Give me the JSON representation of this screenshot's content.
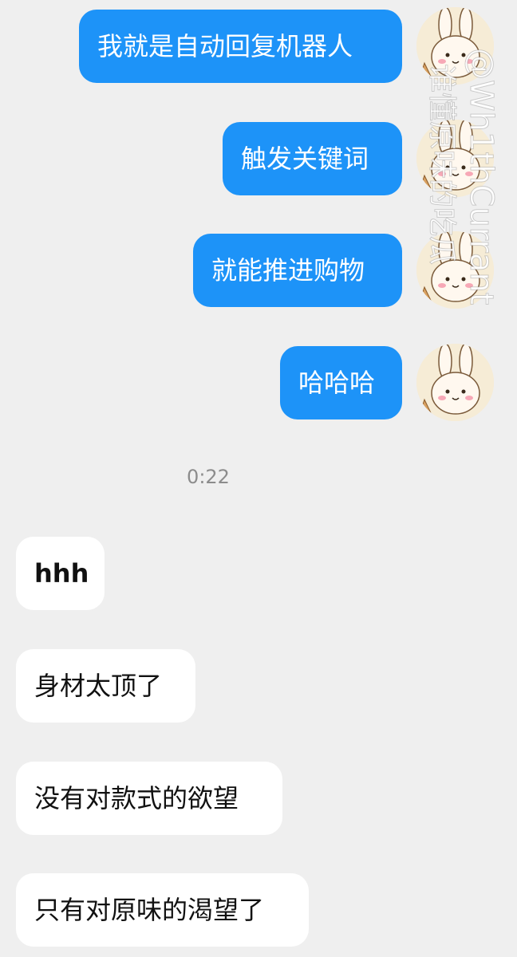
{
  "conversation": {
    "sent_messages": [
      {
        "text": "我就是自动回复机器人"
      },
      {
        "text": "触发关键词"
      },
      {
        "text": "就能推进购物"
      },
      {
        "text": "哈哈哈"
      }
    ],
    "timestamp": "0:22",
    "received_messages": [
      {
        "text": "hhh"
      },
      {
        "text": "身材太顶了"
      },
      {
        "text": "没有对款式的欲望"
      },
      {
        "text": "只有对原味的渴望了"
      }
    ]
  },
  "watermark": {
    "line1": "@Wh1thCurrant",
    "line2": "谁懂原味的吃瓜",
    "color": "#ffffff"
  },
  "colors": {
    "sent_bubble": "#1d93f8",
    "received_bubble": "#ffffff",
    "background": "#efefef",
    "timestamp": "#8c8c8c"
  },
  "avatar": {
    "icon": "cartoon-rabbit-avatar"
  }
}
